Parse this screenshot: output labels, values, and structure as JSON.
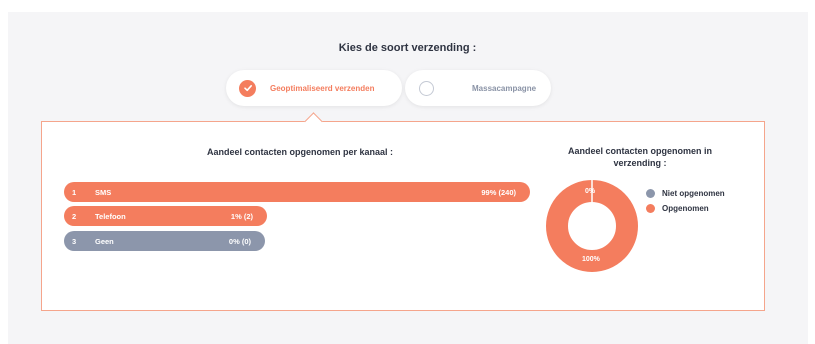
{
  "heading": "Kies de soort verzending :",
  "options": [
    {
      "label": "Geoptimaliseerd verzenden",
      "selected": true
    },
    {
      "label": "Massacampagne",
      "selected": false
    }
  ],
  "left_title": "Aandeel contacten opgenomen per kanaal :",
  "right_title_line1": "Aandeel contacten opgenomen in",
  "right_title_line2": "verzending :",
  "channels": [
    {
      "rank": "1",
      "name": "SMS",
      "value": "99% (240)",
      "color": "#f47d5e"
    },
    {
      "rank": "2",
      "name": "Telefoon",
      "value": "1% (2)",
      "color": "#f47d5e"
    },
    {
      "rank": "3",
      "name": "Geen",
      "value": "0% (0)",
      "color": "#8c96ab"
    }
  ],
  "donut": {
    "top_label": "0%",
    "bottom_label": "100%",
    "not_taken_fraction": 0.0,
    "taken_fraction": 1.0
  },
  "legend": [
    {
      "label": "Niet opgenomen",
      "color": "#8c96ab"
    },
    {
      "label": "Opgenomen",
      "color": "#f47d5e"
    }
  ],
  "colors": {
    "accent": "#f47d5e",
    "grey": "#8c96ab",
    "border": "#f5a58c"
  }
}
